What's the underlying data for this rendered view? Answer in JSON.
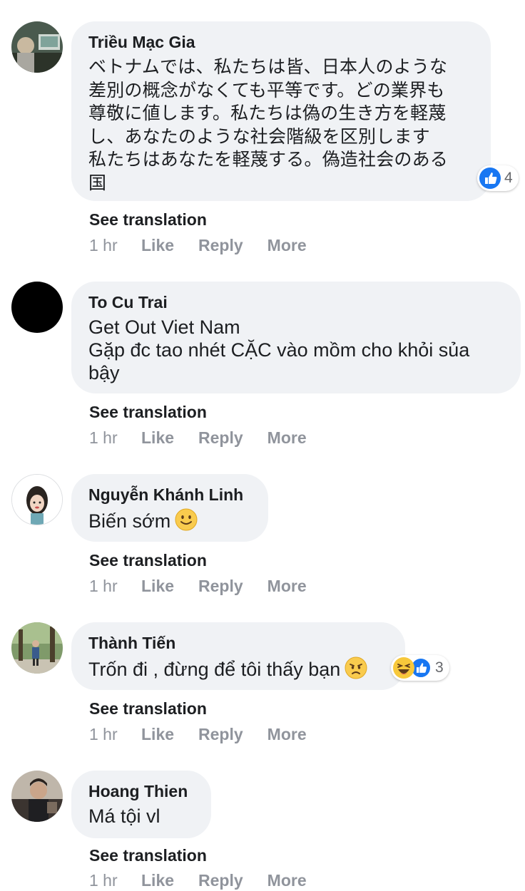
{
  "comments": [
    {
      "author": "Triều Mạc Gia",
      "text": "ベトナムでは、私たちは皆、日本人のような\n差別の概念がなくても平等です。どの業界も\n尊敬に値します。私たちは偽の生き方を軽蔑\nし、あなたのような社会階級を区別します\n私たちはあなたを軽蔑する。偽造社会のある\n国",
      "see_translation": "See translation",
      "time": "1 hr",
      "like": "Like",
      "reply": "Reply",
      "more": "More",
      "reaction_count": "4",
      "reactions": [
        "like-icon"
      ]
    },
    {
      "author": "To Cu Trai",
      "text": "Get Out Viet Nam\nGặp đc tao nhét CẶC vào mồm cho khỏi sủa\nbậy",
      "see_translation": "See translation",
      "time": "1 hr",
      "like": "Like",
      "reply": "Reply",
      "more": "More"
    },
    {
      "author": "Nguyễn Khánh Linh",
      "text": "Biến sớm",
      "emoji": "smiling-face-emoji",
      "see_translation": "See translation",
      "time": "1 hr",
      "like": "Like",
      "reply": "Reply",
      "more": "More"
    },
    {
      "author": "Thành Tiến",
      "text": "Trốn đi , đừng để tôi thấy bạn",
      "emoji": "frowning-face-emoji",
      "see_translation": "See translation",
      "time": "1 hr",
      "like": "Like",
      "reply": "Reply",
      "more": "More",
      "reaction_count": "3",
      "reactions": [
        "haha-icon",
        "like-icon"
      ]
    },
    {
      "author": "Hoang Thien",
      "text": "Má tội vl",
      "see_translation": "See translation",
      "time": "1 hr",
      "like": "Like",
      "reply": "Reply",
      "more": "More"
    }
  ],
  "colors": {
    "bubble": "#f0f2f5",
    "meta_text": "#90949c",
    "like_blue": "#1877f2",
    "haha_yellow": "#f7c83b"
  }
}
